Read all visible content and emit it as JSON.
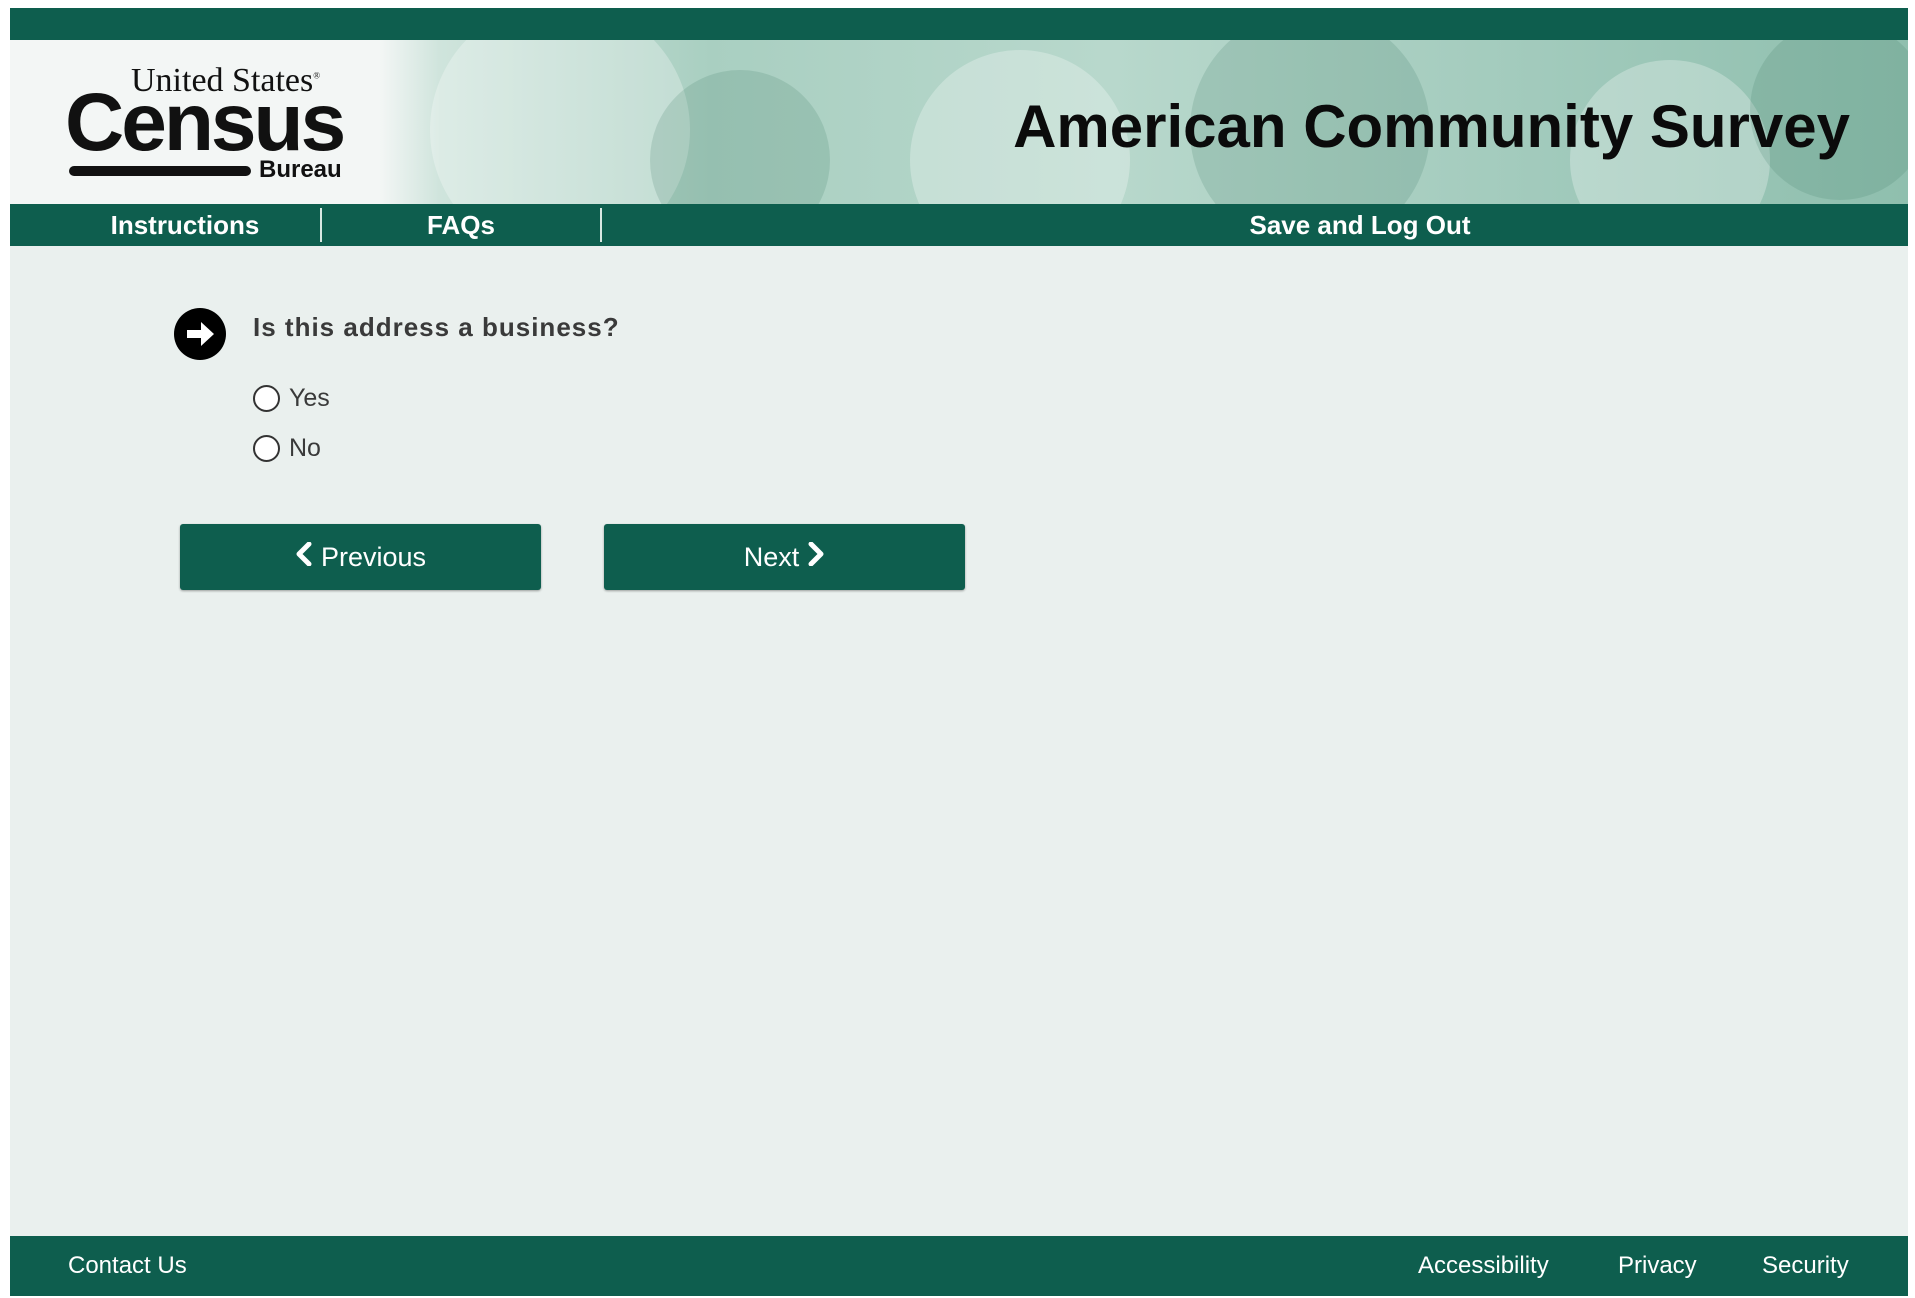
{
  "header": {
    "logo": {
      "line1": "United States",
      "registered": "®",
      "wordmark": "Census",
      "line3": "Bureau"
    },
    "title": "American Community Survey"
  },
  "nav": {
    "instructions": "Instructions",
    "faqs": "FAQs",
    "save_logout": "Save and Log Out"
  },
  "question": {
    "text": "Is this address a business?",
    "icon": "arrow-right-circle-icon",
    "options": [
      {
        "label": "Yes",
        "selected": false
      },
      {
        "label": "No",
        "selected": false
      }
    ]
  },
  "buttons": {
    "previous": "Previous",
    "next": "Next"
  },
  "footer": {
    "contact": "Contact Us",
    "accessibility": "Accessibility",
    "privacy": "Privacy",
    "security": "Security"
  },
  "colors": {
    "brand_green": "#0e5e4e",
    "page_background": "#eaf0ee"
  }
}
